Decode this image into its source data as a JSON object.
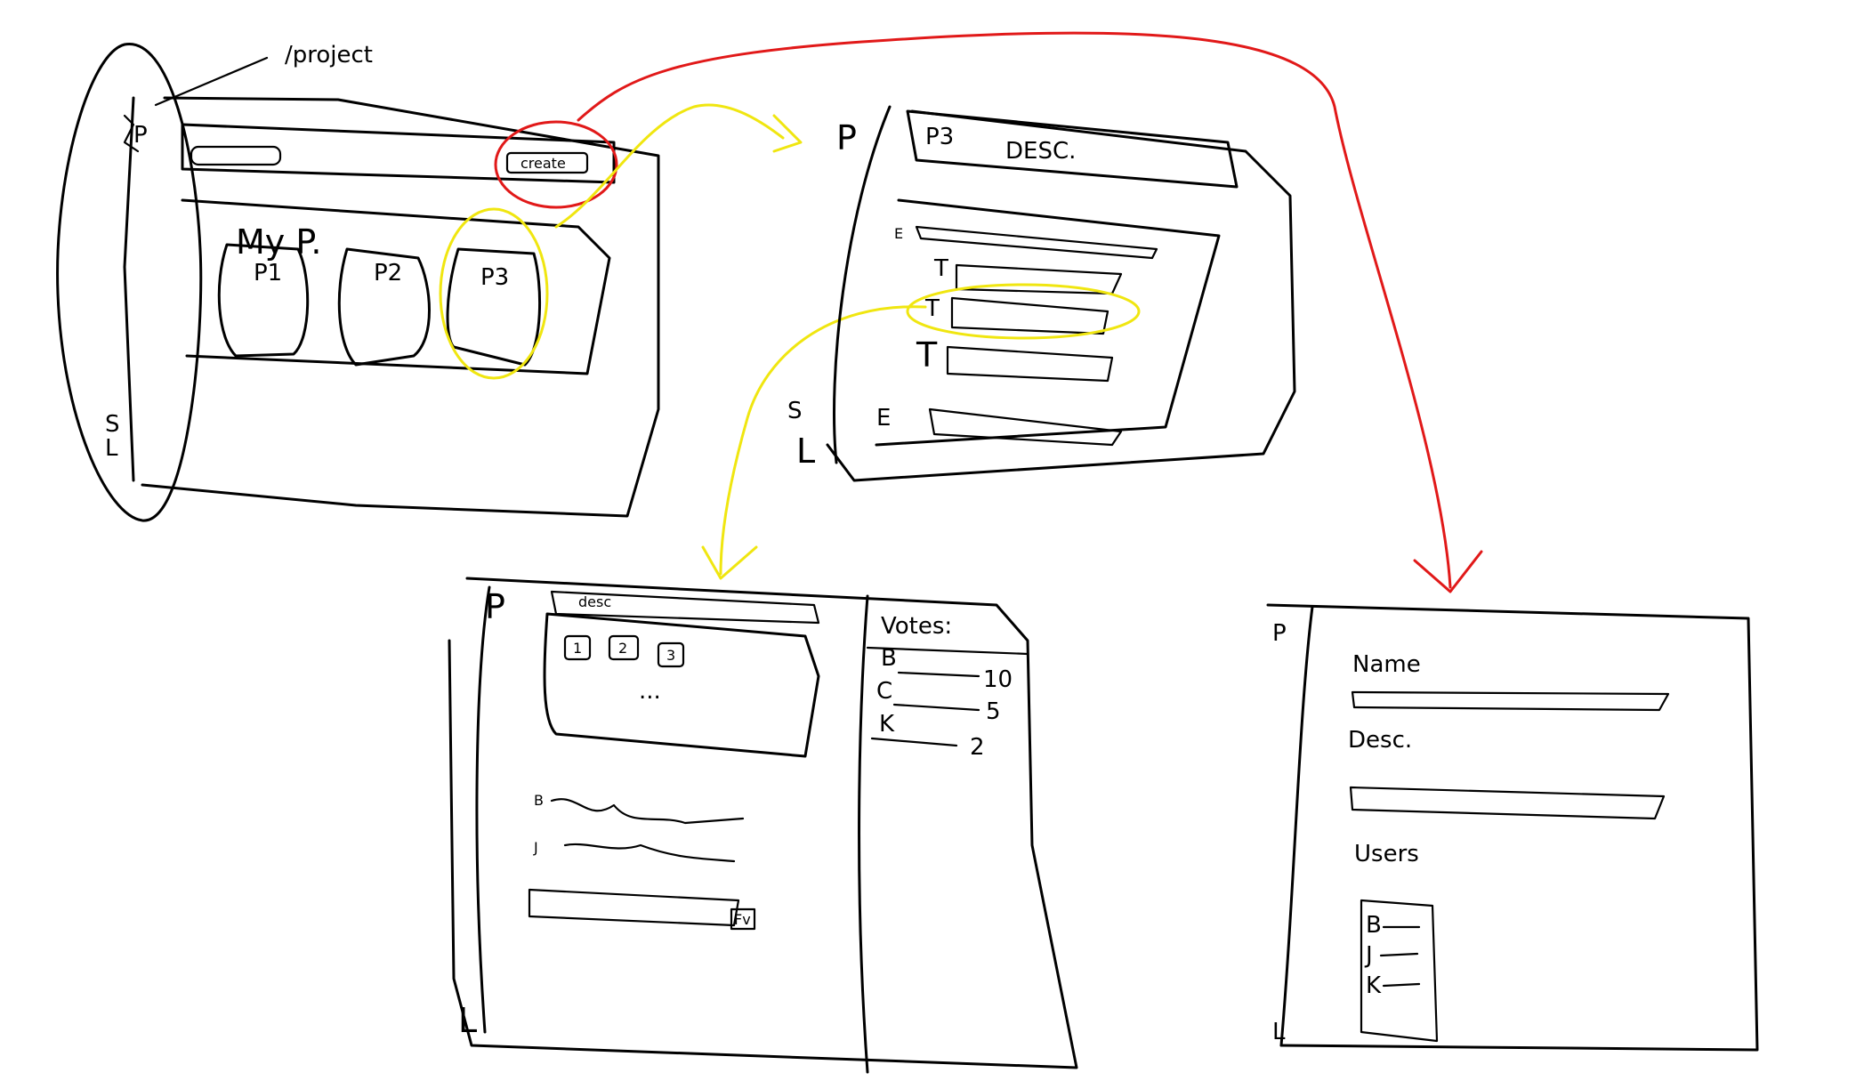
{
  "colors": {
    "ink": "#000000",
    "red_flow": "#e11919",
    "yellow_flow": "#f0e610",
    "background": "#ffffff"
  },
  "sketch1": {
    "tab_label": "/project",
    "logo": "P",
    "create_button": "create",
    "section_title": "My P.",
    "projects": [
      "P1",
      "P2",
      "P3"
    ],
    "sidebar_bottom": [
      "S",
      "L"
    ]
  },
  "sketch2": {
    "sidebar_top": "P",
    "header_project": "P3",
    "header_desc": "DESC.",
    "rows": [
      {
        "kind": "E"
      },
      {
        "kind": "T"
      },
      {
        "kind": "T"
      },
      {
        "kind": "T"
      },
      {
        "kind": "E"
      }
    ],
    "sidebar_bottom": [
      "S",
      "L"
    ]
  },
  "sketch3": {
    "sidebar_top": "P",
    "desc_label": "desc",
    "tabs": [
      "1",
      "2",
      "3"
    ],
    "ellipsis": "...",
    "comments": [
      "B",
      "J"
    ],
    "send_button": "Fv",
    "votes_title": "Votes:",
    "votes": [
      {
        "name": "B",
        "count": "10"
      },
      {
        "name": "C",
        "count": "5"
      },
      {
        "name": "K",
        "count": "2"
      }
    ],
    "sidebar_bottom": "L"
  },
  "sketch4": {
    "sidebar_top": "P",
    "name_label": "Name",
    "desc_label": "Desc.",
    "users_label": "Users",
    "users": [
      "B",
      "J",
      "K"
    ],
    "sidebar_bottom": "L"
  }
}
